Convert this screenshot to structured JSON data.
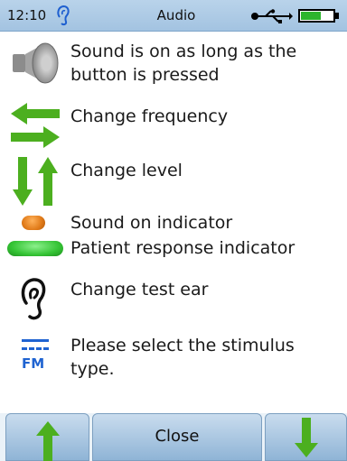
{
  "status_bar": {
    "time": "12:10",
    "title": "Audio",
    "icons": [
      "ear-icon",
      "usb-icon",
      "battery-icon"
    ]
  },
  "help_items": [
    {
      "icon": "speaker-icon",
      "text": "Sound is on as long as the button is pressed"
    },
    {
      "icon": "left-right-arrows-icon",
      "text": "Change frequency"
    },
    {
      "icon": "up-down-arrows-icon",
      "text": "Change level"
    },
    {
      "icon": "orange-indicator-icon",
      "text": "Sound on indicator"
    },
    {
      "icon": "green-indicator-icon",
      "text": "Patient response indicator"
    },
    {
      "icon": "ear-icon",
      "text": "Change test ear"
    },
    {
      "icon": "fm-icon",
      "icon_label": "FM",
      "text": "Please select the stimulus type."
    }
  ],
  "footer": {
    "up_icon": "up-arrow-icon",
    "close_label": "Close",
    "down_icon": "down-arrow-icon"
  },
  "colors": {
    "status_bar": "#a9c8e4",
    "arrow_green": "#4caf1f",
    "indicator_orange": "#e07a18",
    "indicator_green": "#35c435",
    "fm_blue": "#1f63d1"
  }
}
